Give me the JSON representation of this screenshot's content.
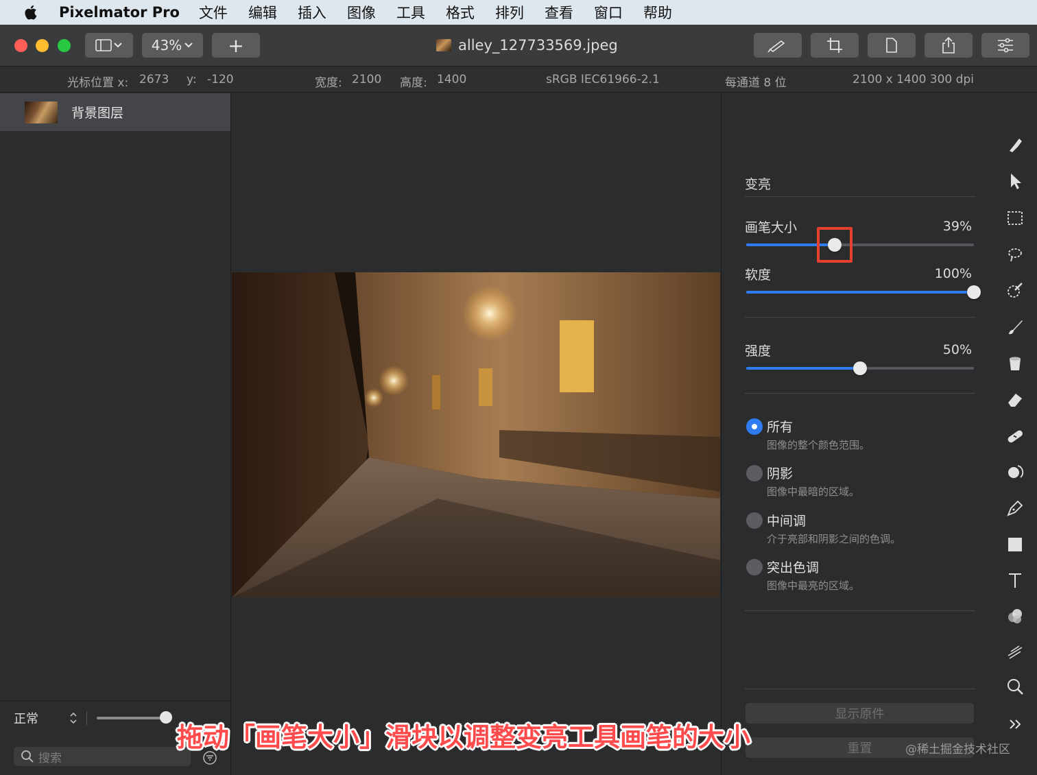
{
  "menubar": {
    "app_name": "Pixelmator Pro",
    "items": [
      "文件",
      "编辑",
      "插入",
      "图像",
      "工具",
      "格式",
      "排列",
      "查看",
      "窗口",
      "帮助"
    ]
  },
  "toolbar": {
    "zoom": "43%",
    "add_label": "+",
    "document_title": "alley_127733569.jpeg"
  },
  "infobar": {
    "cursor_x_label": "光标位置 x:",
    "cursor_x": "2673",
    "cursor_y_label": "y:",
    "cursor_y": "-120",
    "width_label": "宽度:",
    "width": "2100",
    "height_label": "高度:",
    "height": "1400",
    "color_profile": "sRGB IEC61966-2.1",
    "bit_depth": "每通道 8 位",
    "size_dpi": "2100 x 1400 300 dpi"
  },
  "layers": {
    "items": [
      {
        "name": "背景图层"
      }
    ],
    "blend_mode": "正常",
    "search_placeholder": "搜索"
  },
  "tool_panel": {
    "title": "变亮",
    "brush_size": {
      "label": "画笔大小",
      "value": "39%",
      "level": 0.39
    },
    "softness": {
      "label": "软度",
      "value": "100%",
      "level": 1.0
    },
    "strength": {
      "label": "强度",
      "value": "50%",
      "level": 0.5
    },
    "ranges": [
      {
        "title": "所有",
        "desc": "图像的整个颜色范围。",
        "selected": true
      },
      {
        "title": "阴影",
        "desc": "图像中最暗的区域。",
        "selected": false
      },
      {
        "title": "中间调",
        "desc": "介于亮部和阴影之间的色调。",
        "selected": false
      },
      {
        "title": "突出色调",
        "desc": "图像中最亮的区域。",
        "selected": false
      }
    ],
    "show_original": "显示原件",
    "reset": "重置"
  },
  "caption": "拖动「画笔大小」滑块以调整变亮工具画笔的大小",
  "watermark": "@稀土掘金技术社区",
  "colors": {
    "accent": "#2f7bf0",
    "highlight": "#e8402f",
    "caption": "#ff4b4b"
  }
}
